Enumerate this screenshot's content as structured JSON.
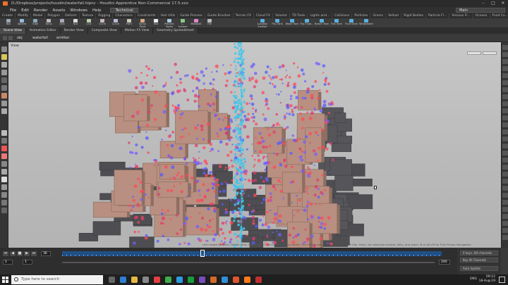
{
  "window": {
    "title": "D:/Dropbox/projects/houdini/waterfall.hipnc - Houdini Apprentice Non-Commercial 17.5.xxx",
    "controls": [
      "–",
      "□",
      "✕"
    ]
  },
  "menubar": {
    "items": [
      "File",
      "Edit",
      "Render",
      "Assets",
      "Windows",
      "Help"
    ],
    "desktop": "Technical",
    "build": "Main"
  },
  "shelf_tabs": [
    "Create",
    "Modify",
    "Model",
    "Polygon",
    "Deform",
    "Texture",
    "Rigging",
    "Characters",
    "Constraints",
    "Hair Utils",
    "Guide Process",
    "Guide Brushes",
    "Terrain FX",
    "Cloud FX",
    "Volume",
    "TD Tools",
    "Lights and...",
    "Collisions",
    "Particles",
    "Grains",
    "Vellum",
    "Rigid Bodies",
    "Particle Fl...",
    "Viscous Fl...",
    "Oceans",
    "Fluid Co...",
    "Populate C...",
    "Container...",
    "Pyro FX",
    "Sparse P...",
    "FEM",
    "Wires",
    "Crowds",
    "Drive Sim"
  ],
  "shelf_tools": [
    "Box",
    "Sphere",
    "Tube",
    "Torus",
    "Grid",
    "Null",
    "Line",
    "Circle",
    "Curve",
    "Path",
    "Spray Paint",
    "Text",
    "Platonic Solids",
    "L-System",
    "Metaball",
    "File"
  ],
  "shelf_tools_right": [
    "Location Emitter",
    "Flip Tank",
    "Wave Tank",
    "Flip Fluid...",
    "Beach Tank",
    "Flat Tank",
    "Fluid Tank",
    "Whitewater"
  ],
  "pane_tabs": [
    "Scene View",
    "Animation Editor",
    "Render View",
    "Composite View",
    "Motion FX View",
    "Geometry Spreadsheet"
  ],
  "path": {
    "level1": "obj",
    "level2": "waterfall",
    "level3": "emitter"
  },
  "viewport": {
    "label": "View",
    "hint": "Left mouse tumbles. Middle pans. Right dollies. Ctrl+Alt+Left box-zooms. Ctrl+Right zooms. Spacebar-Ctrl-Left tilts. Hold L for alternate tumble, dolly, and zoom.    M or Alt+M for First Person Navigation."
  },
  "timeline": {
    "play_buttons": [
      "⏮",
      "◀",
      "■",
      "▶",
      "⏭"
    ],
    "frame": "36",
    "range_start": "1",
    "range_end": "240",
    "current_frame_marker": "36"
  },
  "side_panel": {
    "items": [
      "0 keys, 0/0 channels",
      "Key All Channels",
      "Auto Update"
    ]
  },
  "taskbar": {
    "search_placeholder": "Type here to search",
    "language": "ENG",
    "time": "09:12",
    "date": "18-Aug-19"
  },
  "colors": {
    "particles_red": "#ff4a5a",
    "particles_blue": "#5a5aff",
    "waterfall_core": "#3fc7ea",
    "rocks": "#b88f80",
    "dark_rocks": "#4e4e52",
    "timeline_blue": "#1f4f85"
  }
}
